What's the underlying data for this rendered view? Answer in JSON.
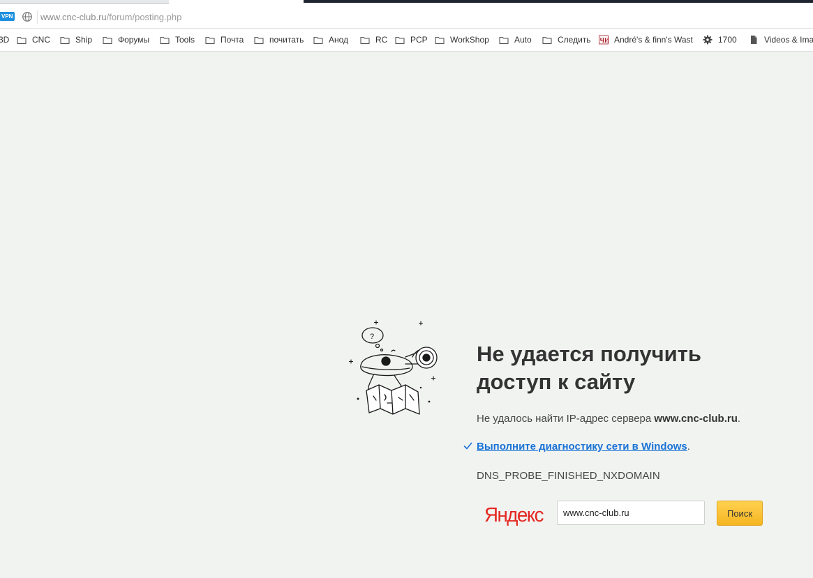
{
  "address_bar": {
    "vpn_badge": "VPN",
    "url_host": "www.cnc-club.ru",
    "url_path": "/forum/posting.php"
  },
  "bookmarks": [
    {
      "label": "3D",
      "icon": "folder-icon"
    },
    {
      "label": "CNC",
      "icon": "folder-icon"
    },
    {
      "label": "Ship",
      "icon": "folder-icon"
    },
    {
      "label": "Форумы",
      "icon": "folder-icon"
    },
    {
      "label": "Tools",
      "icon": "folder-icon"
    },
    {
      "label": "Почта",
      "icon": "folder-icon"
    },
    {
      "label": "почитать",
      "icon": "folder-icon"
    },
    {
      "label": "Анод",
      "icon": "folder-icon"
    },
    {
      "label": "RC",
      "icon": "folder-icon"
    },
    {
      "label": "PCP",
      "icon": "folder-icon"
    },
    {
      "label": "WorkShop",
      "icon": "folder-icon"
    },
    {
      "label": "Auto",
      "icon": "folder-icon"
    },
    {
      "label": "Следить",
      "icon": "folder-icon"
    },
    {
      "label": "André's & finn's Wast",
      "icon": "site-favicon-icon"
    },
    {
      "label": "1700",
      "icon": "gear-favicon-icon"
    },
    {
      "label": "Videos & Ima",
      "icon": "page-icon"
    }
  ],
  "error": {
    "title_line1": "Не удается получить",
    "title_line2": "доступ к сайту",
    "message_prefix": "Не удалось найти IP-адрес сервера ",
    "message_host": "www.cnc-club.ru",
    "message_suffix": ".",
    "diagnostics_link": "Выполните диагностику сети в Windows",
    "diagnostics_suffix": ".",
    "code": "DNS_PROBE_FINISHED_NXDOMAIN"
  },
  "yandex": {
    "logo_text": "Яндекс",
    "search_value": "www.cnc-club.ru",
    "search_button": "Поиск"
  },
  "colors": {
    "page_background": "#f1f3f1",
    "link": "#1a73d6",
    "search_button": "#f5b522",
    "yandex_red": "#e52620",
    "vpn_badge": "#1d8fe0"
  }
}
